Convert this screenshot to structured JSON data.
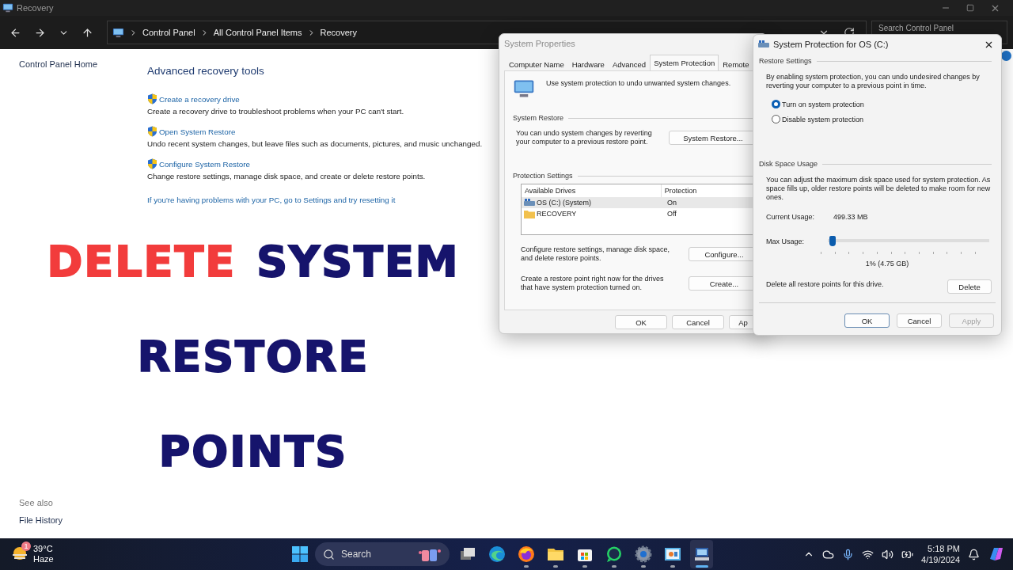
{
  "window": {
    "title": "Recovery",
    "breadcrumb": [
      "Control Panel",
      "All Control Panel Items",
      "Recovery"
    ],
    "search": {
      "placeholder": "Search Control Panel"
    }
  },
  "sidebar": {
    "home_link": "Control Panel Home",
    "see_also": "See also",
    "links": [
      "File History"
    ]
  },
  "main": {
    "heading": "Advanced recovery tools",
    "tools": [
      {
        "link": "Create a recovery drive",
        "description": "Create a recovery drive to troubleshoot problems when your PC can't start."
      },
      {
        "link": "Open System Restore",
        "description": "Undo recent system changes, but leave files such as documents, pictures, and music unchanged."
      },
      {
        "link": "Configure System Restore",
        "description": "Change restore settings, manage disk space, and create or delete restore points."
      }
    ],
    "reset_link": "If you're having problems with your PC, go to Settings and try resetting it"
  },
  "headline": {
    "lines": [
      {
        "words": [
          {
            "text": "DELETE",
            "color": "#f23c3c"
          },
          {
            "text": "SYSTEM",
            "color": "#16146c"
          }
        ]
      },
      {
        "words": [
          {
            "text": "RESTORE",
            "color": "#16146c"
          }
        ]
      },
      {
        "words": [
          {
            "text": "POINTS",
            "color": "#16146c"
          }
        ]
      }
    ]
  },
  "system_properties": {
    "title": "System Properties",
    "tabs": [
      {
        "label": "Computer Name",
        "selected": false
      },
      {
        "label": "Hardware",
        "selected": false
      },
      {
        "label": "Advanced",
        "selected": false
      },
      {
        "label": "System Protection",
        "selected": true
      },
      {
        "label": "Remote",
        "selected": false
      }
    ],
    "intro": "Use system protection to undo unwanted system changes.",
    "restore_group": {
      "label": "System Restore",
      "text": "You can undo system changes by reverting your computer to a previous restore point.",
      "button": "System Restore..."
    },
    "protection_group": {
      "label": "Protection Settings",
      "columns": [
        "Available Drives",
        "Protection"
      ],
      "drives": [
        {
          "name": "OS (C:) (System)",
          "protection": "On",
          "kind": "system",
          "selected": true
        },
        {
          "name": "RECOVERY",
          "protection": "Off",
          "kind": "folder",
          "selected": false
        }
      ],
      "configure_text": "Configure restore settings, manage disk space, and delete restore points.",
      "configure_button": "Configure...",
      "create_text": "Create a restore point right now for the drives that have system protection turned on.",
      "create_button": "Create..."
    },
    "buttons": [
      {
        "label": "OK"
      },
      {
        "label": "Cancel"
      },
      {
        "label": "Ap"
      }
    ]
  },
  "protection_dialog": {
    "title": "System Protection for OS (C:)",
    "restore_settings": {
      "label": "Restore Settings",
      "text": "By enabling system protection, you can undo undesired changes by reverting your computer to a previous point in time.",
      "options": [
        {
          "label": "Turn on system protection",
          "selected": true
        },
        {
          "label": "Disable system protection",
          "selected": false
        }
      ]
    },
    "disk_space": {
      "label": "Disk Space Usage",
      "text": "You can adjust the maximum disk space used for system protection. As space fills up, older restore points will be deleted to make room for new ones.",
      "current_label": "Current Usage:",
      "current_value": "499.33 MB",
      "max_label": "Max Usage:",
      "max_slider": {
        "level": 0.01
      },
      "max_value": "1% (4.75 GB)",
      "delete_text": "Delete all restore points for this drive.",
      "delete_button": "Delete"
    },
    "buttons": [
      {
        "label": "OK",
        "disabled": false
      },
      {
        "label": "Cancel",
        "disabled": false
      },
      {
        "label": "Apply",
        "disabled": true
      }
    ]
  },
  "taskbar": {
    "weather": {
      "badge": "1",
      "temperature": "39°C",
      "condition": "Haze"
    },
    "search": {
      "placeholder": "Search"
    },
    "apps": [
      {
        "kind": "taskview",
        "running": false,
        "active": false
      },
      {
        "kind": "edge",
        "running": false,
        "active": false
      },
      {
        "kind": "firefox",
        "running": true,
        "active": false
      },
      {
        "kind": "folder",
        "running": true,
        "active": false
      },
      {
        "kind": "store",
        "running": true,
        "active": false
      },
      {
        "kind": "whatsapp",
        "running": true,
        "active": false
      },
      {
        "kind": "settings",
        "running": true,
        "active": false
      },
      {
        "kind": "chart",
        "running": true,
        "active": false
      },
      {
        "kind": "sysprops",
        "running": true,
        "active": true
      }
    ],
    "time": "5:18 PM",
    "date": "4/19/2024"
  }
}
